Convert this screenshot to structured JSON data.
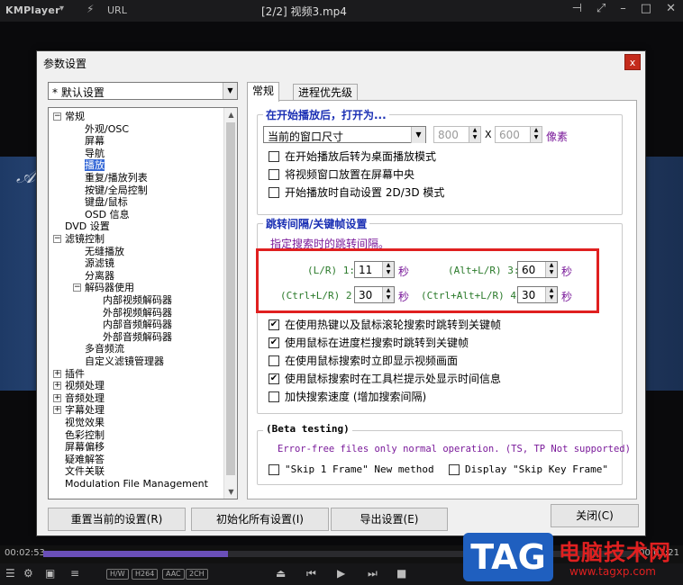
{
  "player": {
    "brand": "KMPlayer",
    "brand_menu": "▾",
    "url_label": "URL",
    "title": "[2/2] 视频3.mp4",
    "time_elapsed": "00:02:53",
    "time_total": "00:03:21",
    "progress_fraction": 0.31,
    "badges": [
      "H/W",
      "H264",
      "AAC",
      "2CH"
    ]
  },
  "dialog": {
    "title": "参数设置",
    "preset": "* 默认设置",
    "tabs": [
      "常规",
      "进程优先级"
    ],
    "tree": [
      {
        "label": "常规",
        "level": 0,
        "expander": "minus"
      },
      {
        "label": "外观/OSC",
        "level": 1
      },
      {
        "label": "屏幕",
        "level": 1
      },
      {
        "label": "导航",
        "level": 1
      },
      {
        "label": "播放",
        "level": 1,
        "selected": true
      },
      {
        "label": "重复/播放列表",
        "level": 1
      },
      {
        "label": "按键/全局控制",
        "level": 1
      },
      {
        "label": "键盘/鼠标",
        "level": 1
      },
      {
        "label": "OSD 信息",
        "level": 1
      },
      {
        "label": "DVD 设置",
        "level": 0
      },
      {
        "label": "滤镜控制",
        "level": 0,
        "expander": "minus"
      },
      {
        "label": "无缝播放",
        "level": 1
      },
      {
        "label": "源滤镜",
        "level": 1
      },
      {
        "label": "分离器",
        "level": 1
      },
      {
        "label": "解码器使用",
        "level": 1,
        "expander": "minus"
      },
      {
        "label": "内部视频解码器",
        "level": 2
      },
      {
        "label": "外部视频解码器",
        "level": 2
      },
      {
        "label": "内部音频解码器",
        "level": 2
      },
      {
        "label": "外部音频解码器",
        "level": 2
      },
      {
        "label": "多音频流",
        "level": 1
      },
      {
        "label": "自定义滤镜管理器",
        "level": 1
      },
      {
        "label": "插件",
        "level": 0,
        "expander": "plus"
      },
      {
        "label": "视频处理",
        "level": 0,
        "expander": "plus"
      },
      {
        "label": "音频处理",
        "level": 0,
        "expander": "plus"
      },
      {
        "label": "字幕处理",
        "level": 0,
        "expander": "plus"
      },
      {
        "label": "视觉效果",
        "level": 0
      },
      {
        "label": "色彩控制",
        "level": 0
      },
      {
        "label": "屏幕偏移",
        "level": 0
      },
      {
        "label": "疑难解答",
        "level": 0
      },
      {
        "label": "文件关联",
        "level": 0
      },
      {
        "label": "Modulation File Management",
        "level": 0
      }
    ],
    "group_open": {
      "title": "在开始播放后，打开为...",
      "size_mode": "当前的窗口尺寸",
      "width": "800",
      "times": "X",
      "height": "600",
      "unit": "像素",
      "checks": [
        {
          "label": "在开始播放后转为桌面播放模式",
          "checked": false
        },
        {
          "label": "将视频窗口放置在屏幕中央",
          "checked": false
        },
        {
          "label": "开始播放时自动设置 2D/3D 模式",
          "checked": false
        }
      ]
    },
    "group_seek": {
      "title": "跳转间隔/关键帧设置",
      "hint": "指定搜索时的跳转间隔。",
      "intervals": [
        {
          "label": "(L/R) 1:",
          "value": "11",
          "unit": "秒"
        },
        {
          "label": "(Alt+L/R) 3:",
          "value": "60",
          "unit": "秒"
        },
        {
          "label": "(Ctrl+L/R) 2:",
          "value": "30",
          "unit": "秒"
        },
        {
          "label": "(Ctrl+Alt+L/R) 4:",
          "value": "30",
          "unit": "秒"
        }
      ],
      "checks": [
        {
          "label": "在使用热键以及鼠标滚轮搜索时跳转到关键帧",
          "checked": true
        },
        {
          "label": "使用鼠标在进度栏搜索时跳转到关键帧",
          "checked": true
        },
        {
          "label": "在使用鼠标搜索时立即显示视频画面",
          "checked": false
        },
        {
          "label": "使用鼠标搜索时在工具栏提示处显示时间信息",
          "checked": true
        },
        {
          "label": "加快搜索速度 (增加搜索间隔)",
          "checked": false
        }
      ]
    },
    "group_beta": {
      "title": "(Beta testing)",
      "note": "Error-free files only normal operation. (TS, TP Not supported)",
      "checks": [
        {
          "label": "\"Skip 1 Frame\" New method",
          "checked": false
        },
        {
          "label": "Display \"Skip Key Frame\"",
          "checked": false
        }
      ]
    },
    "buttons": {
      "reset_current": "重置当前的设置(R)",
      "init_all": "初始化所有设置(I)",
      "export": "导出设置(E)",
      "close": "关闭(C)"
    }
  },
  "watermark": {
    "tag": "TAG",
    "name": "电脑技术网",
    "url": "www.tagxp.com"
  },
  "colors": {
    "highlight": "#e02020",
    "tree_selection": "#3367d6",
    "group_title": "#1a2fb4",
    "progress_fill": "#6a4fb8"
  }
}
